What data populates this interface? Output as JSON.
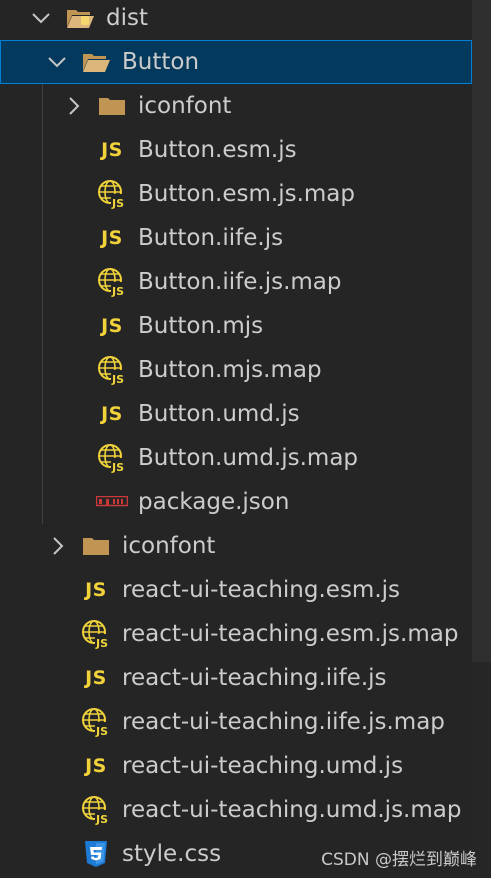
{
  "tree": {
    "dist": {
      "label": "dist",
      "icon": "folder-open-special-icon",
      "expanded": true
    },
    "button_folder": {
      "label": "Button",
      "icon": "folder-open-icon",
      "expanded": true,
      "selected": true
    },
    "button_children": [
      {
        "label": "iconfont",
        "icon": "folder-icon",
        "kind": "folder"
      },
      {
        "label": "Button.esm.js",
        "icon": "js-icon",
        "kind": "js"
      },
      {
        "label": "Button.esm.js.map",
        "icon": "map-icon",
        "kind": "map"
      },
      {
        "label": "Button.iife.js",
        "icon": "js-icon",
        "kind": "js"
      },
      {
        "label": "Button.iife.js.map",
        "icon": "map-icon",
        "kind": "map"
      },
      {
        "label": "Button.mjs",
        "icon": "js-icon",
        "kind": "js"
      },
      {
        "label": "Button.mjs.map",
        "icon": "map-icon",
        "kind": "map"
      },
      {
        "label": "Button.umd.js",
        "icon": "js-icon",
        "kind": "js"
      },
      {
        "label": "Button.umd.js.map",
        "icon": "map-icon",
        "kind": "map"
      },
      {
        "label": "package.json",
        "icon": "npm-icon",
        "kind": "npm"
      }
    ],
    "dist_children": [
      {
        "label": "iconfont",
        "icon": "folder-icon",
        "kind": "folder"
      },
      {
        "label": "react-ui-teaching.esm.js",
        "icon": "js-icon",
        "kind": "js"
      },
      {
        "label": "react-ui-teaching.esm.js.map",
        "icon": "map-icon",
        "kind": "map"
      },
      {
        "label": "react-ui-teaching.iife.js",
        "icon": "js-icon",
        "kind": "js"
      },
      {
        "label": "react-ui-teaching.iife.js.map",
        "icon": "map-icon",
        "kind": "map"
      },
      {
        "label": "react-ui-teaching.umd.js",
        "icon": "js-icon",
        "kind": "js"
      },
      {
        "label": "react-ui-teaching.umd.js.map",
        "icon": "map-icon",
        "kind": "map"
      },
      {
        "label": "style.css",
        "icon": "css-icon",
        "kind": "css"
      }
    ]
  },
  "js_icon_text": "JS",
  "watermark": "CSDN @摆烂到巅峰",
  "colors": {
    "background": "#252526",
    "selection": "#04395e",
    "selection_border": "#007fd4",
    "js": "#f0d23a",
    "folder": "#c09553",
    "npm": "#cb3837",
    "css": "#1e7bd3"
  }
}
